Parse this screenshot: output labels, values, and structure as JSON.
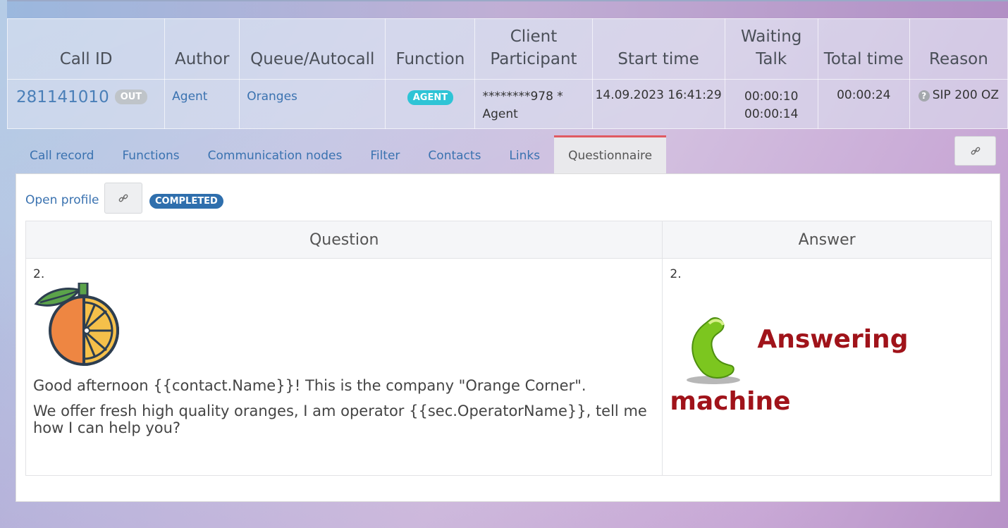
{
  "calls_table": {
    "headers": [
      "Call ID",
      "Author",
      "Queue/Autocall",
      "Function",
      "Client\nParticipant",
      "Start time",
      "Waiting\nTalk",
      "Total time",
      "Reason"
    ],
    "row": {
      "call_id": "281141010",
      "direction_badge": "OUT",
      "author": "Agent",
      "queue": "Oranges",
      "function_badge": "AGENT",
      "client": "********978 *",
      "participant": "Agent",
      "start_time": "14.09.2023 16:41:29",
      "waiting": "00:00:10",
      "talk": "00:00:14",
      "total_time": "00:00:24",
      "reason": "SIP 200 OZ",
      "reason_icon": "question-circle-icon"
    }
  },
  "tabs": [
    {
      "label": "Call record",
      "active": false
    },
    {
      "label": "Functions",
      "active": false
    },
    {
      "label": "Communication nodes",
      "active": false
    },
    {
      "label": "Filter",
      "active": false
    },
    {
      "label": "Contacts",
      "active": false
    },
    {
      "label": "Links",
      "active": false
    },
    {
      "label": "Questionnaire",
      "active": true
    }
  ],
  "questionnaire": {
    "open_profile_label": "Open profile",
    "status_badge": "COMPLETED",
    "headers": {
      "question": "Question",
      "answer": "Answer"
    },
    "question": {
      "number": "2.",
      "image_icon": "orange-fruit-icon",
      "line1": "Good afternoon {{contact.Name}}! This is the company \"Orange Corner\".",
      "line2": "We offer fresh high quality oranges, I am operator {{sec.OperatorName}}, tell me how I can help you?"
    },
    "answer": {
      "number": "2.",
      "image_icon": "phone-handset-icon",
      "word1": "Answering",
      "word2": "machine"
    }
  },
  "colors": {
    "accent_link": "#3a72b0",
    "badge_agent": "#2ec4d6",
    "badge_completed": "#2f6fad",
    "tab_active_border": "#e05a62",
    "answer_text": "#a0131a"
  }
}
